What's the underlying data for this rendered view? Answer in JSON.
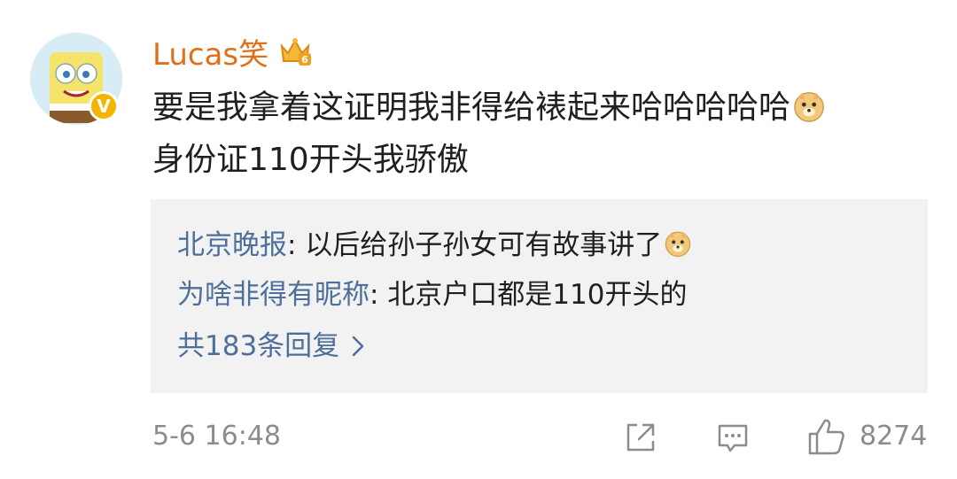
{
  "comment": {
    "username": "Lucas笑",
    "text_line1": "要是我拿着这证明我非得给裱起来哈哈哈哈哈",
    "text_line2": "身份证110开头我骄傲",
    "timestamp": "5-6 16:48",
    "like_count": "8274"
  },
  "replies": [
    {
      "name": "北京晚报",
      "text": ": 以后给孙子孙女可有故事讲了"
    },
    {
      "name": "为啥非得有昵称",
      "text": ": 北京户口都是110开头的"
    }
  ],
  "more_replies": {
    "label": "共183条回复"
  },
  "colors": {
    "username": "#e06f18",
    "link": "#4d6f9a",
    "meta": "#8c8c8c",
    "reply_bg": "#f2f2f2"
  },
  "icons": [
    "avatar",
    "verified-badge-icon",
    "vip-crown-icon",
    "doge-emoji-icon",
    "chevron-right-icon",
    "share-icon",
    "comment-icon",
    "thumbs-up-icon"
  ]
}
